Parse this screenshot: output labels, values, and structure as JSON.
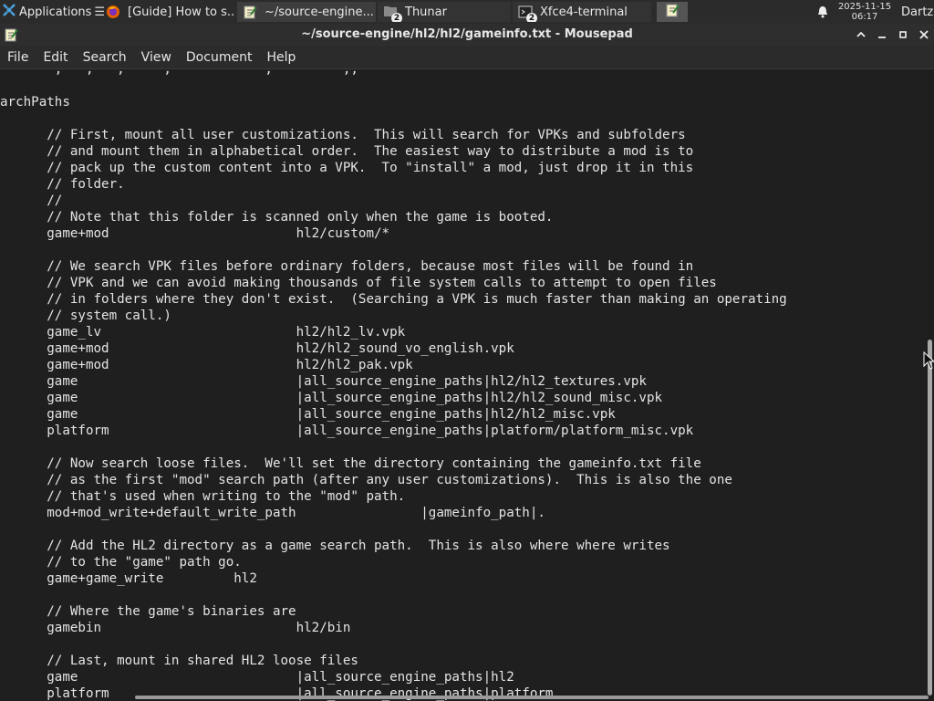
{
  "taskbar": {
    "applications_label": "Applications",
    "tasks": [
      {
        "label": "[Guide] How to s...",
        "icon": "firefox-icon"
      },
      {
        "label": "~/source-engine...",
        "icon": "mousepad-icon"
      },
      {
        "label": "Thunar",
        "icon": "thunar-icon",
        "badge": "2"
      },
      {
        "label": "Xfce4-terminal",
        "icon": "terminal-icon",
        "badge": "2"
      }
    ],
    "clock_date": "2025-11-15",
    "clock_time": "06:17",
    "user": "Dartz"
  },
  "window": {
    "title": "~/source-engine/hl2/hl2/gameinfo.txt - Mousepad"
  },
  "menubar": {
    "items": [
      "File",
      "Edit",
      "Search",
      "View",
      "Document",
      "Help"
    ]
  },
  "editor": {
    "lines": [
      "       ,   ,   ,     ,            ,         ,,",
      "",
      "archPaths",
      "",
      "      // First, mount all user customizations.  This will search for VPKs and subfolders",
      "      // and mount them in alphabetical order.  The easiest way to distribute a mod is to",
      "      // pack up the custom content into a VPK.  To \"install\" a mod, just drop it in this",
      "      // folder.",
      "      //",
      "      // Note that this folder is scanned only when the game is booted.",
      "      game+mod                        hl2/custom/*",
      "",
      "      // We search VPK files before ordinary folders, because most files will be found in",
      "      // VPK and we can avoid making thousands of file system calls to attempt to open files",
      "      // in folders where they don't exist.  (Searching a VPK is much faster than making an operating",
      "      // system call.)",
      "      game_lv                         hl2/hl2_lv.vpk",
      "      game+mod                        hl2/hl2_sound_vo_english.vpk",
      "      game+mod                        hl2/hl2_pak.vpk",
      "      game                            |all_source_engine_paths|hl2/hl2_textures.vpk",
      "      game                            |all_source_engine_paths|hl2/hl2_sound_misc.vpk",
      "      game                            |all_source_engine_paths|hl2/hl2_misc.vpk",
      "      platform                        |all_source_engine_paths|platform/platform_misc.vpk",
      "",
      "      // Now search loose files.  We'll set the directory containing the gameinfo.txt file",
      "      // as the first \"mod\" search path (after any user customizations).  This is also the one",
      "      // that's used when writing to the \"mod\" path.",
      "      mod+mod_write+default_write_path                |gameinfo_path|.",
      "",
      "      // Add the HL2 directory as a game search path.  This is also where where writes",
      "      // to the \"game\" path go.",
      "      game+game_write         hl2",
      "",
      "      // Where the game's binaries are",
      "      gamebin                         hl2/bin",
      "",
      "      // Last, mount in shared HL2 loose files",
      "      game                            |all_source_engine_paths|hl2",
      "      platform                        |all_source_engine_paths|platform"
    ]
  }
}
